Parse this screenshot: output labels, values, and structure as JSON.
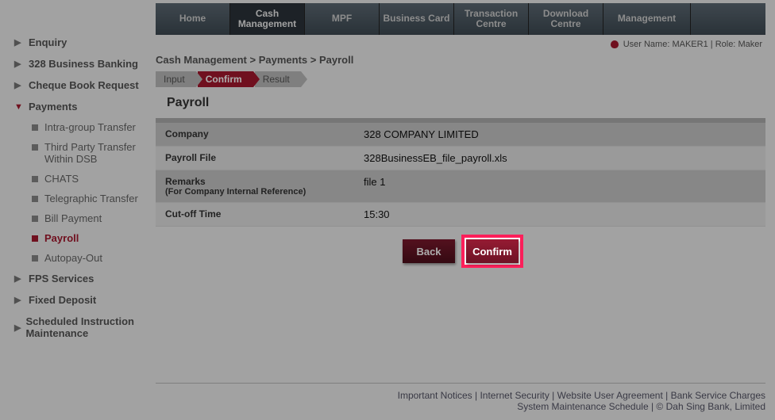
{
  "topnav": {
    "items": [
      {
        "label": "Home"
      },
      {
        "label": "Cash Management"
      },
      {
        "label": "MPF"
      },
      {
        "label": "Business Card"
      },
      {
        "label": "Transaction Centre"
      },
      {
        "label": "Download Centre"
      },
      {
        "label": "Management"
      }
    ],
    "active_index": 1
  },
  "userbar": {
    "username_label": "User Name:",
    "username": "MAKER1",
    "role_label": "Role:",
    "role": "Maker"
  },
  "breadcrumb": {
    "a": "Cash Management",
    "b": "Payments",
    "c": "Payroll"
  },
  "steps": {
    "input": "Input",
    "confirm": "Confirm",
    "result": "Result"
  },
  "page_title": "Payroll",
  "form": {
    "company_label": "Company",
    "company_value": "328 COMPANY LIMITED",
    "file_label": "Payroll File",
    "file_value": "328BusinessEB_file_payroll.xls",
    "remarks_label": "Remarks",
    "remarks_sub": "(For Company Internal Reference)",
    "remarks_value": "file 1",
    "cutoff_label": "Cut-off Time",
    "cutoff_value": "15:30"
  },
  "buttons": {
    "back": "Back",
    "confirm": "Confirm"
  },
  "sidebar": {
    "items": [
      {
        "label": "Enquiry"
      },
      {
        "label": "328 Business Banking"
      },
      {
        "label": "Cheque Book Request"
      },
      {
        "label": "Payments"
      },
      {
        "label": "FPS Services"
      },
      {
        "label": "Fixed Deposit"
      },
      {
        "label": "Scheduled Instruction Maintenance"
      }
    ],
    "payments_sub": [
      {
        "label": "Intra-group Transfer"
      },
      {
        "label": "Third Party Transfer Within DSB"
      },
      {
        "label": "CHATS"
      },
      {
        "label": "Telegraphic Transfer"
      },
      {
        "label": "Bill Payment"
      },
      {
        "label": "Payroll"
      },
      {
        "label": "Autopay-Out"
      }
    ]
  },
  "footer": {
    "a": "Important Notices",
    "b": "Internet Security",
    "c": "Website User Agreement",
    "d": "Bank Service Charges",
    "e": "System Maintenance Schedule",
    "copyright": "© Dah Sing Bank, Limited"
  }
}
